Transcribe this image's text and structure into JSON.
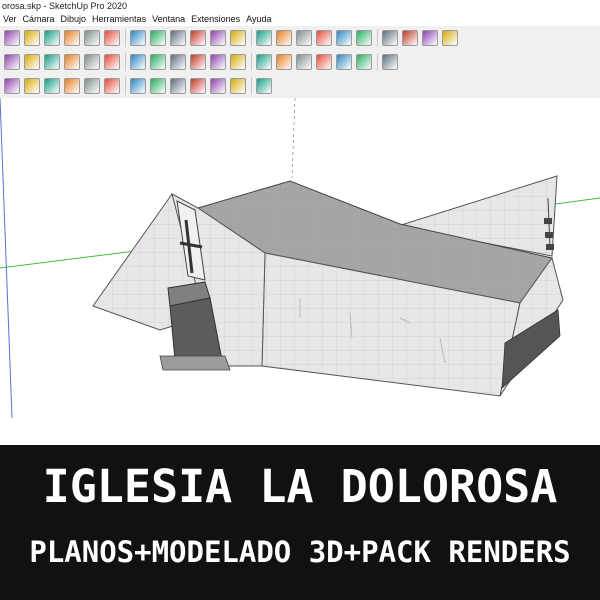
{
  "window": {
    "title": "orosa.skp - SketchUp Pro 2020"
  },
  "menu": [
    "Ver",
    "Cámara",
    "Dibujo",
    "Herramientas",
    "Ventana",
    "Extensiones",
    "Ayuda"
  ],
  "banner": {
    "title": "IGLESIA LA DOLOROSA",
    "subtitle": "PLANOS+MODELADO 3D+PACK RENDERS"
  },
  "toolbar_icons": {
    "row1": [
      "pencil-icon",
      "arc-icon",
      "rectangle-icon",
      "push-pull-icon",
      "move-icon",
      "rotate-icon",
      "scale-icon",
      "tape-icon",
      "text-icon",
      "paint-icon",
      "orbit-icon",
      "pan-icon",
      "zoom-icon",
      "zoom-extents-icon",
      "warehouse-icon",
      "extension-icon",
      "send-icon",
      "ruby-icon",
      "user-icon",
      "layout-icon",
      "style-icon",
      "component-icon"
    ],
    "row2": [
      "select-icon",
      "eraser-icon",
      "material-icon",
      "shadow-icon",
      "section-icon",
      "walk-icon",
      "look-icon",
      "position-camera-icon",
      "fog-icon",
      "edges-icon",
      "axes-icon",
      "dimension-icon",
      "protractor-icon",
      "xray-icon",
      "wireframe-icon",
      "hidden-line-icon",
      "shaded-icon",
      "textured-icon",
      "monochrome-icon"
    ],
    "row3": [
      "line-icon",
      "circle-icon",
      "polygon-icon",
      "follow-me-icon",
      "offset-icon",
      "intersect-icon",
      "outliner-icon",
      "scenes-icon",
      "sandbox-icon",
      "sound-icon",
      "settings-icon",
      "chat-icon",
      "import-icon"
    ]
  }
}
